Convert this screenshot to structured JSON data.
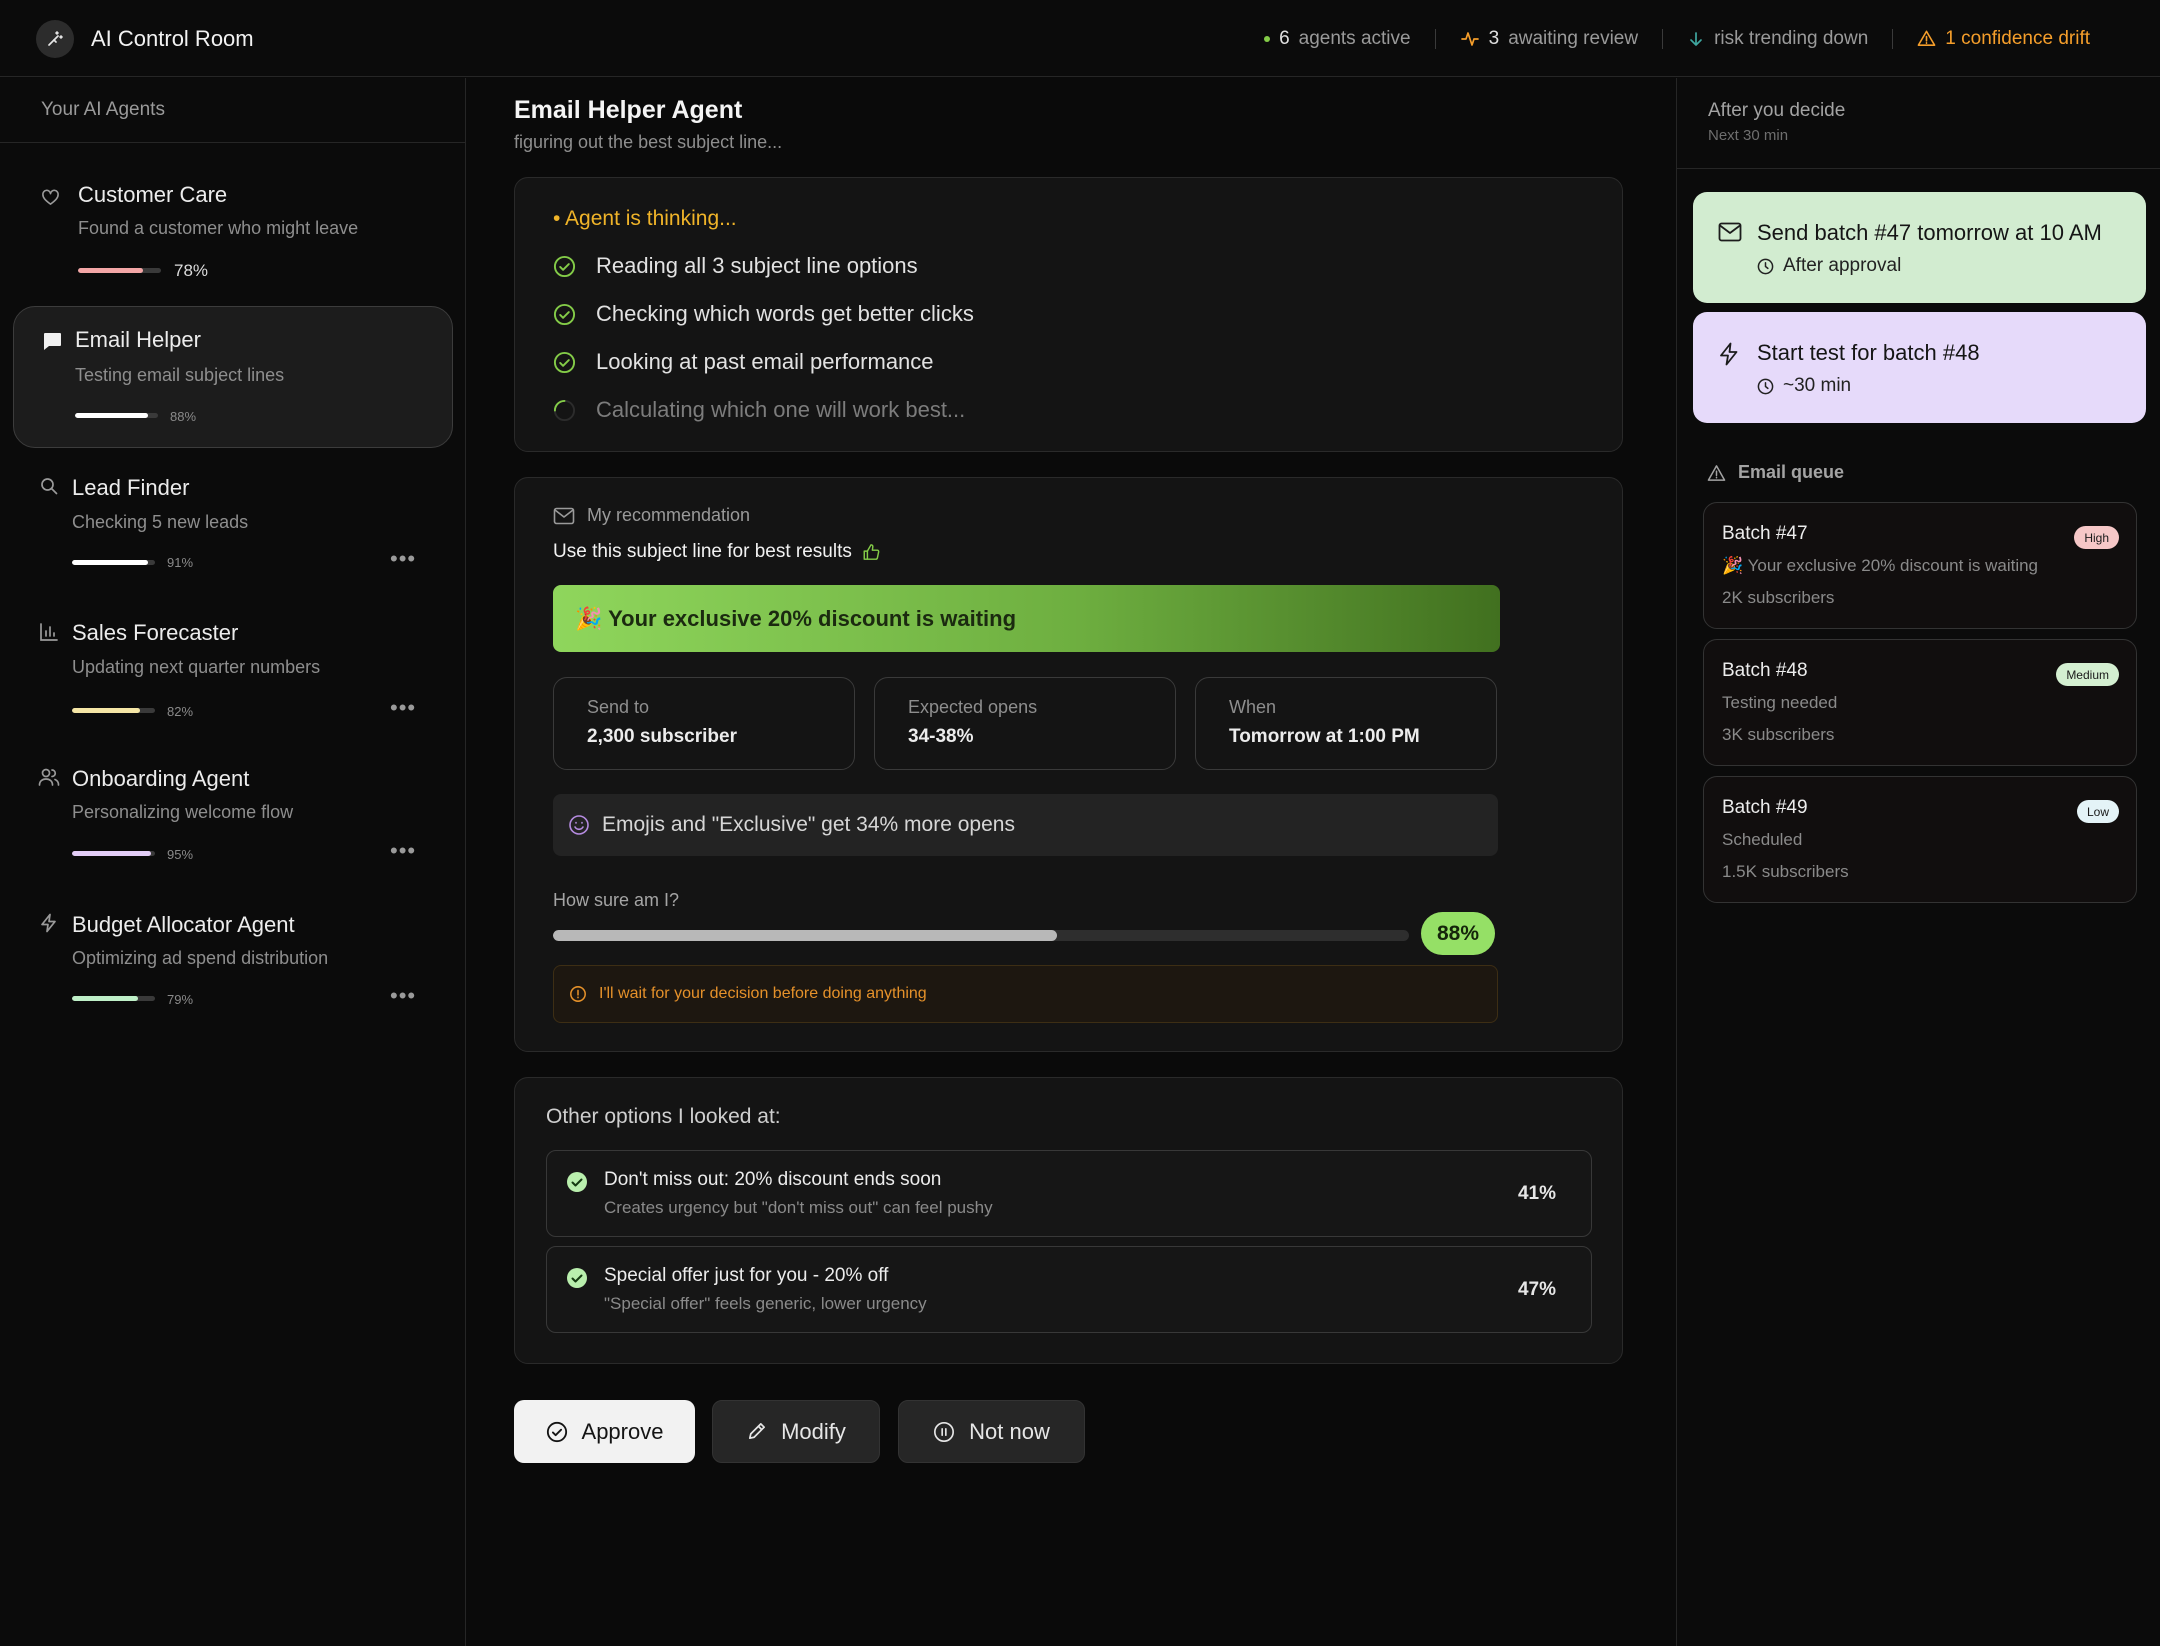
{
  "header": {
    "title": "AI Control Room",
    "stats": {
      "active_num": "6",
      "active_label": "agents active",
      "review_num": "3",
      "review_label": "awaiting review",
      "risk_label": "risk trending down",
      "drift_label": "1 confidence drift"
    },
    "colors": {
      "accent_green": "#84cc48",
      "warning": "#f59e2b",
      "risk": "#3fa7a0"
    }
  },
  "sidebar": {
    "title": "Your AI Agents",
    "agents": [
      {
        "name": "Customer Care",
        "desc": "Found a customer who might leave",
        "pct_text": "78%",
        "progress": 0.78,
        "color": "#f4a7a7",
        "icon": "heart-icon"
      },
      {
        "name": "Email Helper",
        "desc": "Testing email subject lines",
        "pct_text": "88%",
        "progress": 0.88,
        "color": "#ffffff",
        "icon": "chat-bubble-icon"
      },
      {
        "name": "Lead Finder",
        "desc": "Checking 5 new leads",
        "pct_text": "91%",
        "progress": 0.91,
        "color": "#ffffff",
        "icon": "search-icon"
      },
      {
        "name": "Sales Forecaster",
        "desc": "Updating next quarter numbers",
        "pct_text": "82%",
        "progress": 0.82,
        "color": "#f5e6a6",
        "icon": "bar-chart-icon"
      },
      {
        "name": "Onboarding Agent",
        "desc": "Personalizing welcome flow",
        "pct_text": "95%",
        "progress": 0.95,
        "color": "#e3cdf7",
        "icon": "users-icon"
      },
      {
        "name": "Budget Allocator Agent",
        "desc": "Optimizing ad spend distribution",
        "pct_text": "79%",
        "progress": 0.79,
        "color": "#bff0c8",
        "icon": "bolt-icon"
      }
    ]
  },
  "main": {
    "title": "Email Helper Agent",
    "subtitle": "figuring out the best subject line...",
    "thinking": {
      "title": "• Agent is thinking...",
      "steps": [
        "Reading all 3 subject line options",
        "Checking which words get better clicks",
        "Looking at past email performance",
        "Calculating which one will work best..."
      ]
    },
    "recommendation": {
      "label": "My recommendation",
      "heading": "Use this subject line for best results",
      "subject": "🎉 Your exclusive 20% discount is waiting",
      "send_to_label": "Send to",
      "send_to_value": "2,300 subscriber",
      "opens_label": "Expected opens",
      "opens_value": "34-38%",
      "when_label": "When",
      "when_value": "Tomorrow at 1:00 PM",
      "insight": "Emojis and \"Exclusive\" get 34% more opens",
      "confidence_label": "How sure am I?",
      "confidence_text": "88%",
      "confidence": 0.88,
      "wait_note": "I'll wait for your decision before doing anything"
    },
    "other": {
      "title": "Other options I looked at:",
      "options": [
        {
          "title": "Don't miss out: 20% discount ends soon",
          "sub": "Creates urgency but \"don't miss out\" can feel pushy",
          "pct": "41%"
        },
        {
          "title": "Special offer just for you - 20% off",
          "sub": "\"Special offer\" feels generic, lower urgency",
          "pct": "47%"
        }
      ]
    },
    "actions": {
      "approve": "Approve",
      "modify": "Modify",
      "not_now": "Not now"
    }
  },
  "right": {
    "title": "After you decide",
    "subtitle": "Next 30 min",
    "actions": [
      {
        "title": "Send batch #47 tomorrow at 10 AM",
        "meta": "After approval",
        "color": "#d2ecd0"
      },
      {
        "title": "Start test for batch #48",
        "meta": "~30 min",
        "color": "#e6dafa"
      }
    ],
    "queue_title": "Email queue",
    "queue": [
      {
        "name": "Batch #47",
        "line": "🎉 Your exclusive 20% discount is waiting",
        "subs": "2K subscribers",
        "badge": "High",
        "badge_color": "#f6c7c7"
      },
      {
        "name": "Batch #48",
        "line": "Testing needed",
        "subs": "3K subscribers",
        "badge": "Medium",
        "badge_color": "#d4efd1"
      },
      {
        "name": "Batch #49",
        "line": "Scheduled",
        "subs": "1.5K subscribers",
        "badge": "Low",
        "badge_color": "#e4f3f7"
      }
    ]
  }
}
